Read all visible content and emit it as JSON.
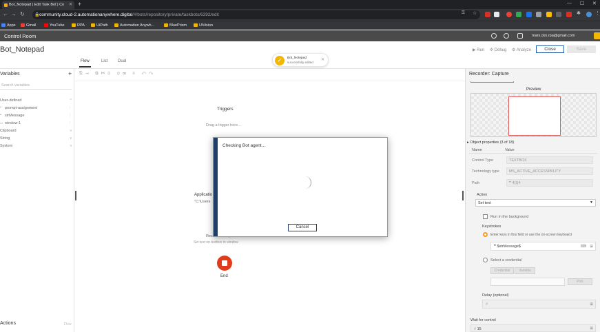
{
  "browser": {
    "tab_title": "Bot_Notepad | Edit Task Bot | Co",
    "url_host": "community.cloud-2.automationanywhere.digital",
    "url_path": "/#/bots/repository/private/taskbots/6392/edit",
    "bookmarks": [
      {
        "label": "Apps",
        "color": "#4285f4"
      },
      {
        "label": "Gmail",
        "color": "#ea4335"
      },
      {
        "label": "YouTube",
        "color": "#ff0000"
      },
      {
        "label": "RPA",
        "color": "#f4b400"
      },
      {
        "label": "UiPath",
        "color": "#f4b400"
      },
      {
        "label": "Automation Anywh...",
        "color": "#f4b400"
      },
      {
        "label": "BluePrism",
        "color": "#f4b400"
      },
      {
        "label": "UiVision",
        "color": "#f4b400"
      }
    ]
  },
  "app_header": {
    "title": "Control Room",
    "email": "mars.ckn.rpa@gmail.com"
  },
  "botbar": {
    "bot_name": "Bot_Notepad",
    "view_tabs": [
      "Flow",
      "List",
      "Dual"
    ],
    "active_view": "Flow",
    "toast": {
      "title": "Bot_Notepad",
      "message": "successfully edited"
    },
    "actions": {
      "run": "Run",
      "debug": "Debug",
      "analyze": "Analyze"
    },
    "close_label": "Close",
    "save_label": "Save"
  },
  "left_panel": {
    "title": "Variables",
    "search_placeholder": "Search variables",
    "sections": [
      {
        "label": "User-defined",
        "type": "section"
      },
      {
        "label": "prompt-assignment",
        "type": "var",
        "icon": "quote"
      },
      {
        "label": "strMessage",
        "type": "var",
        "icon": "quote"
      },
      {
        "label": "window-1",
        "type": "var",
        "icon": "window"
      },
      {
        "label": "Clipboard",
        "type": "section"
      },
      {
        "label": "String",
        "type": "section"
      },
      {
        "label": "System",
        "type": "section"
      }
    ],
    "actions_title": "Actions",
    "actions_right": "Flow"
  },
  "canvas": {
    "triggers_label": "Triggers",
    "drag_trigger": "Drag a trigger here...",
    "app_node_title": "Applicatio",
    "app_node_path": "\"C:\\Users",
    "recorder_title": "Recorder: Capture",
    "recorder_desc": "Set text on textbox in window",
    "end_label": "End"
  },
  "right_panel": {
    "title": "Recorder: Capture",
    "preview_label": "Preview",
    "object_properties": "Object properties (3 of 18)",
    "col_name": "Name",
    "col_value": "Value",
    "props": [
      {
        "name": "Control Type",
        "value": "TEXTBOX"
      },
      {
        "name": "Technology type",
        "value": "MS_ACTIVE_ACCESSIBILITY"
      },
      {
        "name": "Path",
        "value": "4|1|4"
      }
    ],
    "action_label": "Action",
    "action_value": "Set text",
    "run_bg_label": "Run in the background",
    "keystrokes_label": "Keystrokes",
    "keystrokes_option": "Enter keys in this field or use the on-screen keyboard",
    "keystrokes_value": "$strMessage$",
    "credential_option": "Select a credential",
    "credential_tab": "Credential",
    "variable_tab": "Variable",
    "pick_label": "Pick",
    "delay_label": "Delay (optional)",
    "wait_label": "Wait for control",
    "wait_value": "15"
  },
  "modal": {
    "title": "Checking Bot agent...",
    "cancel_label": "Cancel"
  }
}
